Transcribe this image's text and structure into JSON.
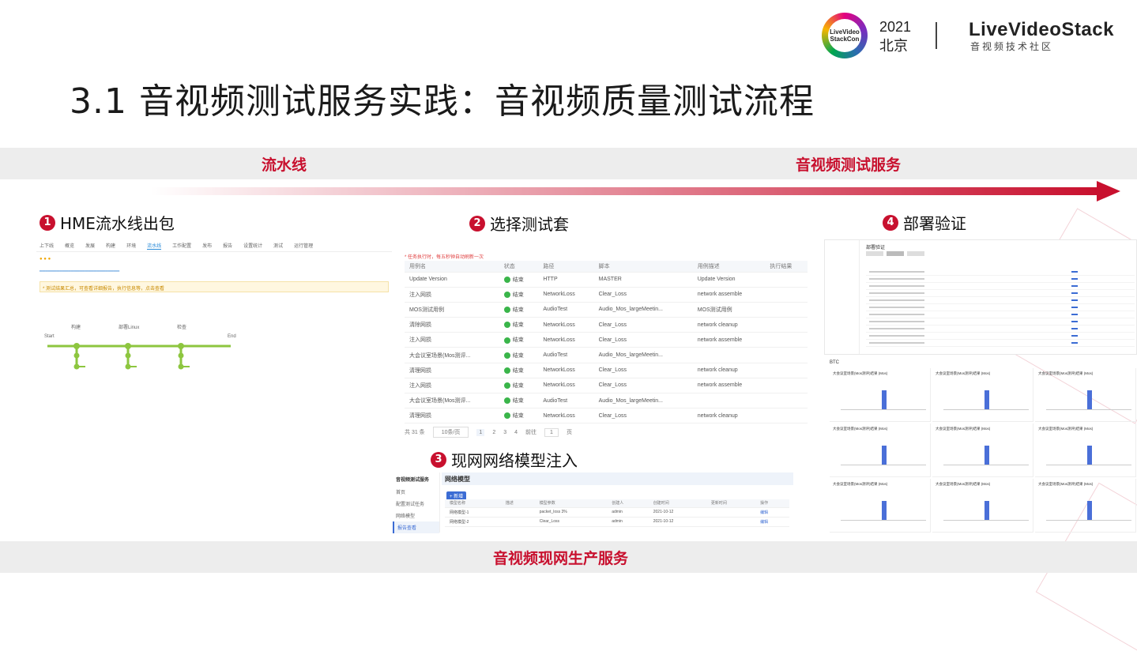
{
  "header": {
    "conference_year": "2021",
    "conference_city": "北京",
    "logo_line1": "LiveVideo",
    "logo_line2": "StackCon",
    "brand": "LiveVideoStack",
    "brand_sub": "音视频技术社区"
  },
  "title": "3.1 音视频测试服务实践：音视频质量测试流程",
  "top_band": {
    "left_label": "流水线",
    "right_label": "音视频测试服务"
  },
  "bottom_band": {
    "label": "音视频现网生产服务"
  },
  "steps": [
    {
      "num": "1",
      "label": "HME流水线出包"
    },
    {
      "num": "2",
      "label": "选择测试套"
    },
    {
      "num": "3",
      "label": "现网网络模型注入"
    },
    {
      "num": "4",
      "label": "部署验证"
    }
  ],
  "panel1": {
    "tabs": [
      "上下线",
      "概览",
      "发展",
      "构建",
      "环境",
      "流水线",
      "工作配置",
      "发布",
      "报告",
      "设置统计",
      "测试",
      "运行管理"
    ],
    "notice": "* 测试结果汇总，可查看详细报告，执行信息等，点击查看",
    "nodes": [
      "构建",
      "部署Linux",
      "检查"
    ],
    "start": "Start",
    "end": "End"
  },
  "panel2": {
    "hint": "* 任务执行时，每五秒钟自动刷新一次",
    "columns": [
      "用例名",
      "状态",
      "路径",
      "脚本",
      "用例描述",
      "执行结果"
    ],
    "rows": [
      [
        "Update Version",
        "结束",
        "HTTP",
        "MASTER",
        "Update Version",
        ""
      ],
      [
        "注入网损",
        "结束",
        "NetworkLoss",
        "Clear_Loss",
        "network assemble",
        ""
      ],
      [
        "MOS测试用例",
        "结束",
        "AudioTest",
        "Audio_Mos_largeMeetin...",
        "MOS测试用例",
        ""
      ],
      [
        "清除网损",
        "结束",
        "NetworkLoss",
        "Clear_Loss",
        "network cleanup",
        ""
      ],
      [
        "注入网损",
        "结束",
        "NetworkLoss",
        "Clear_Loss",
        "network assemble",
        ""
      ],
      [
        "大会议室场景(Mos测评...",
        "结束",
        "AudioTest",
        "Audio_Mos_largeMeetin...",
        "",
        ""
      ],
      [
        "清理网损",
        "结束",
        "NetworkLoss",
        "Clear_Loss",
        "network cleanup",
        ""
      ],
      [
        "注入网损",
        "结束",
        "NetworkLoss",
        "Clear_Loss",
        "network assemble",
        ""
      ],
      [
        "大会议室场景(Mos测评...",
        "结束",
        "AudioTest",
        "Audio_Mos_largeMeetin...",
        "",
        ""
      ],
      [
        "清理网损",
        "结束",
        "NetworkLoss",
        "Clear_Loss",
        "network cleanup",
        ""
      ]
    ],
    "pagination": {
      "total": "共 31 条",
      "page_size": "10条/页",
      "pages": [
        "1",
        "2",
        "3",
        "4"
      ],
      "goto": "前往",
      "goto_page": "1",
      "goto_suffix": "页"
    }
  },
  "panel3": {
    "sidebar_title": "音视频测试服务",
    "sidebar_items": [
      "首页",
      "配置测试任务",
      "网络模型",
      "报告查看"
    ],
    "header": "网络模型",
    "add_button": "+ 新增",
    "columns": [
      "模型名称",
      "描述",
      "模型参数",
      "创建人",
      "创建时间",
      "更新时间",
      "操作"
    ],
    "rows": [
      [
        "网络模型-1",
        "",
        "packet_loss 3%",
        "admin",
        "2021-10-12",
        "",
        "编辑"
      ],
      [
        "网络模型-2",
        "",
        "Clear_Loss",
        "admin",
        "2021-10-12",
        "",
        "编辑"
      ]
    ]
  },
  "panel4": {
    "header": "部署验证",
    "section_label": "BTC",
    "chart_title": "大会议室场景(Mos测评)结果 (Mos)",
    "charts": 9
  }
}
